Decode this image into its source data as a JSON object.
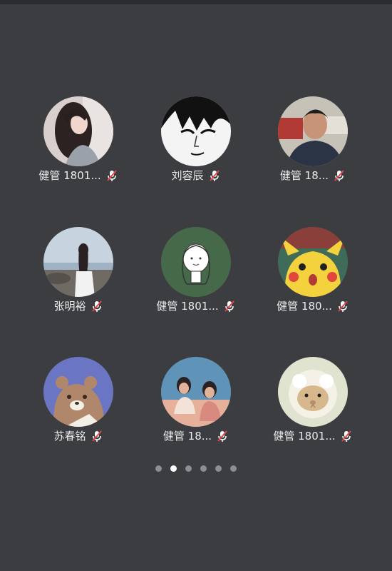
{
  "participants": [
    {
      "name": "健管 1801...",
      "avatar": "long-hair-girl-portrait",
      "mic": "muted"
    },
    {
      "name": "刘容辰",
      "avatar": "manga-face",
      "mic": "muted"
    },
    {
      "name": "健管 18...",
      "avatar": "man-photo",
      "mic": "muted"
    },
    {
      "name": "张明裕",
      "avatar": "girl-by-sea",
      "mic": "muted"
    },
    {
      "name": "健管 1801...",
      "avatar": "sketch-girl-green",
      "mic": "muted"
    },
    {
      "name": "健管 180...",
      "avatar": "pikachu",
      "mic": "muted"
    },
    {
      "name": "苏春铭",
      "avatar": "cartoon-bear",
      "mic": "muted"
    },
    {
      "name": "健管 18...",
      "avatar": "two-people-photo",
      "mic": "muted"
    },
    {
      "name": "健管 1801...",
      "avatar": "sheep-guinea-pig",
      "mic": "muted"
    }
  ],
  "pager": {
    "count": 6,
    "active_index": 1
  },
  "colors": {
    "background": "#3b3d40",
    "muted_slash": "#e0474c",
    "label_text": "#e9eaec"
  }
}
